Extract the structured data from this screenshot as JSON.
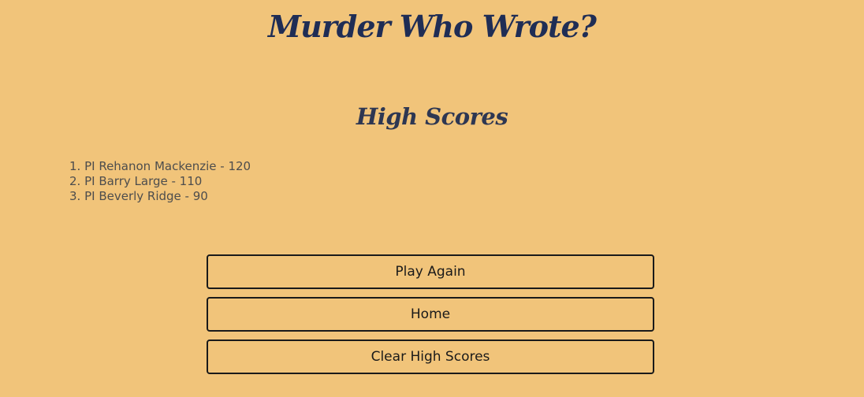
{
  "app": {
    "title": "Murder Who Wrote?"
  },
  "high_scores": {
    "heading": "High Scores",
    "entries": [
      "1. PI Rehanon Mackenzie - 120",
      "2. PI Barry Large - 110",
      "3. PI Beverly Ridge - 90"
    ]
  },
  "buttons": {
    "play_again": "Play Again",
    "home": "Home",
    "clear_high_scores": "Clear High Scores"
  },
  "colors": {
    "background": "#f1c47a",
    "title": "#1f2d55",
    "button_border": "#1a1a1a"
  }
}
